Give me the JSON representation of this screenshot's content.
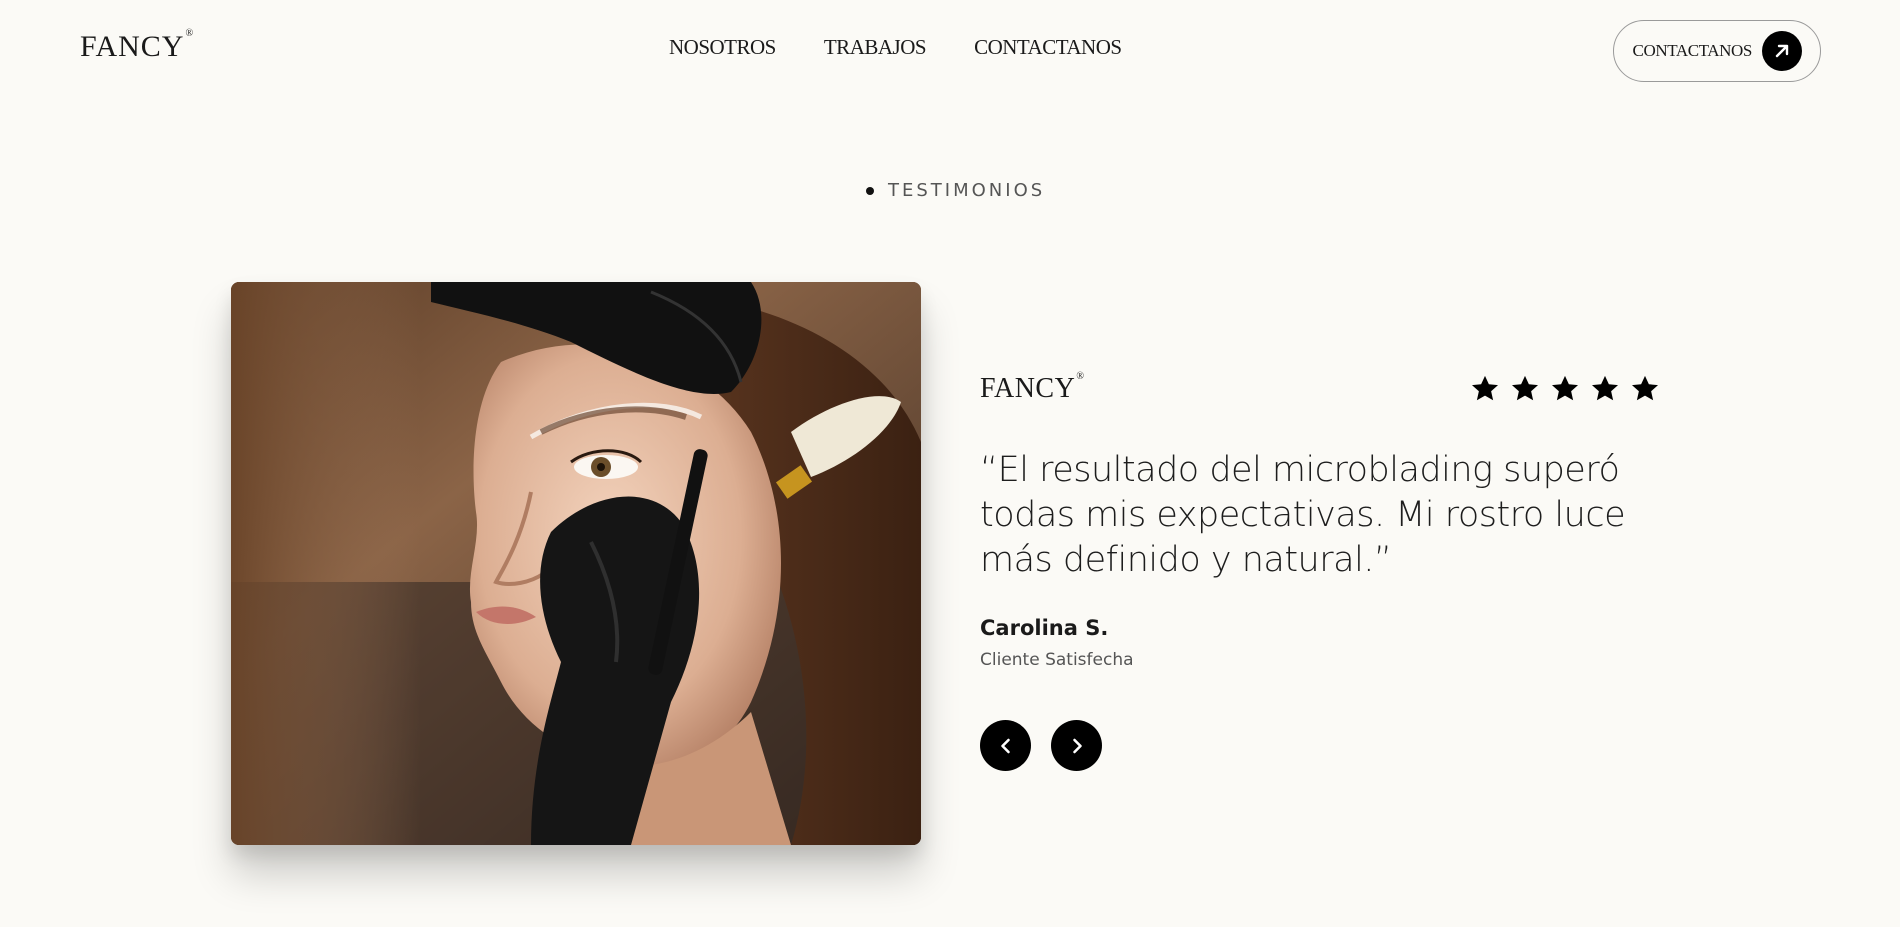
{
  "header": {
    "logo": "FANCY",
    "logo_mark": "®",
    "nav": [
      {
        "label": "NOSOTROS"
      },
      {
        "label": "TRABAJOS"
      },
      {
        "label": "CONTACTANOS"
      }
    ],
    "cta_label": "CONTACTANOS",
    "cta_icon": "arrow-up-right-icon"
  },
  "section": {
    "label": "TESTIMONIOS"
  },
  "testimonial": {
    "brand": "FANCY",
    "brand_mark": "®",
    "rating": 5,
    "rating_max": 5,
    "quote": "“El resultado del microblading superó todas mis expectativas. Mi rostro luce más definido y natural.”",
    "author": "Carolina S.",
    "role": "Cliente Satisfecha"
  },
  "controls": {
    "prev_icon": "chevron-left-icon",
    "next_icon": "chevron-right-icon"
  },
  "colors": {
    "background": "#fbfaf6",
    "accent": "#000000",
    "text": "#1a1a1a",
    "muted": "#555555"
  }
}
